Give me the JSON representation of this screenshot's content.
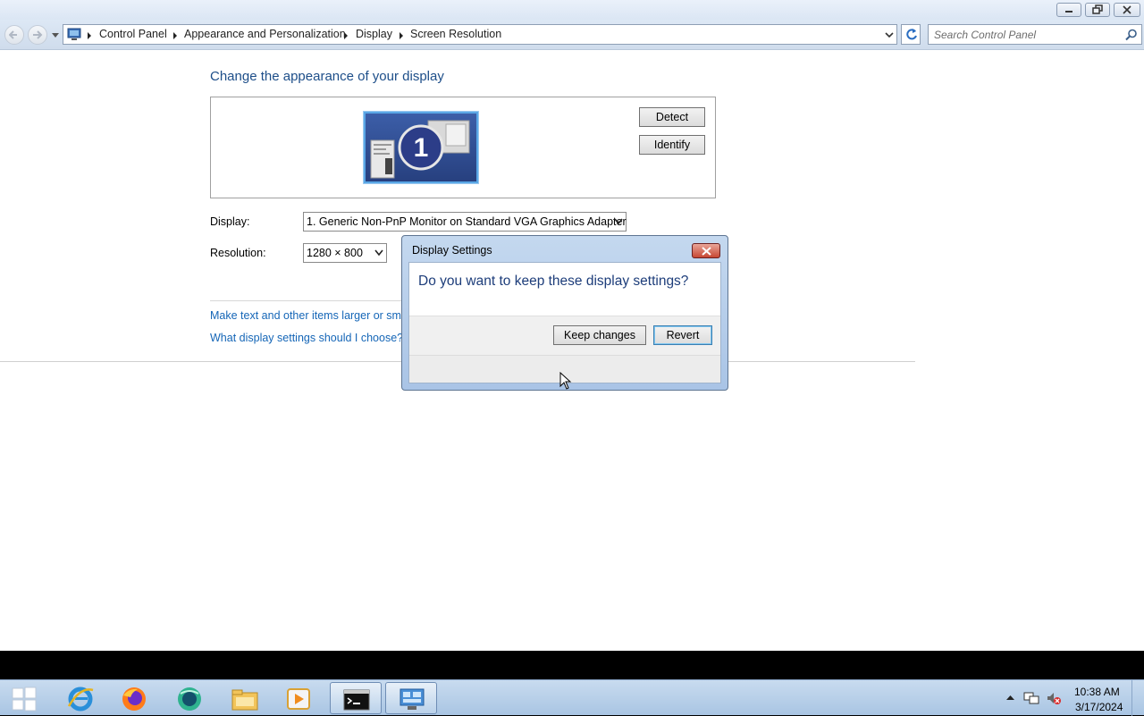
{
  "address_bar": {
    "crumbs": [
      "Control Panel",
      "Appearance and Personalization",
      "Display",
      "Screen Resolution"
    ]
  },
  "search": {
    "placeholder": "Search Control Panel"
  },
  "content": {
    "title": "Change the appearance of your display",
    "monitor_number": "1",
    "detect_label": "Detect",
    "identify_label": "Identify",
    "display_label": "Display:",
    "display_value": "1. Generic Non-PnP Monitor on Standard VGA Graphics Adapter",
    "resolution_label": "Resolution:",
    "resolution_value": "1280 × 800",
    "link_text_size": "Make text and other items larger or smaller",
    "link_help": "What display settings should I choose?"
  },
  "dialog": {
    "title": "Display Settings",
    "question": "Do you want to keep these display settings?",
    "keep_label": "Keep changes",
    "revert_label": "Revert"
  },
  "taskbar": {
    "items": [
      "start-button",
      "internet-explorer-icon",
      "firefox-icon",
      "app-icon",
      "file-explorer-icon",
      "media-player-icon",
      "command-prompt-icon",
      "control-panel-icon"
    ],
    "time": "10:38 AM",
    "date": "3/17/2024"
  },
  "colors": {
    "title_blue": "#1d4e89",
    "link_blue": "#1566b7",
    "taskbar": "#a9c5e3"
  }
}
